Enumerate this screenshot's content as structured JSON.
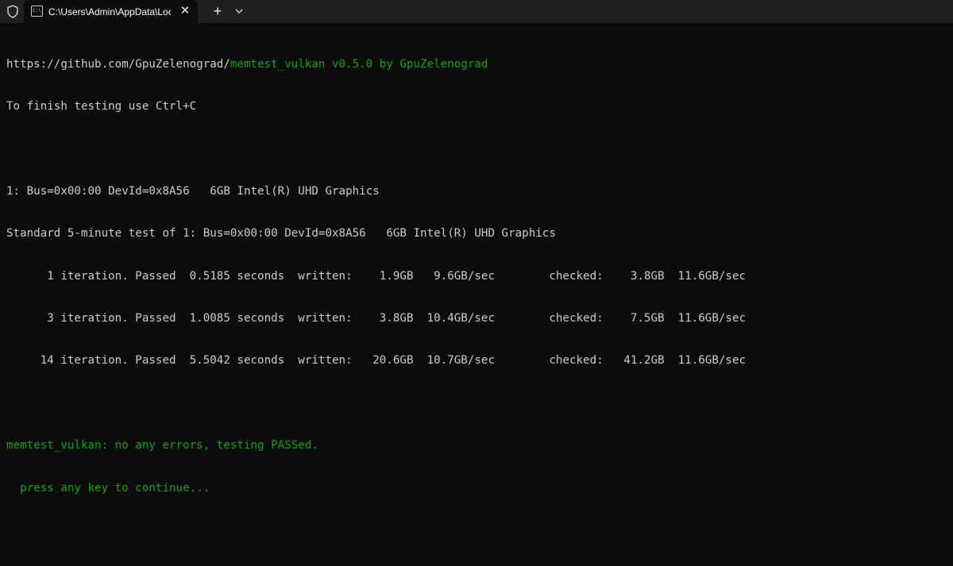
{
  "titlebar": {
    "tab_title": "C:\\Users\\Admin\\AppData\\Local\\Temp\\memtest_vulkan.exe",
    "tab_icon_text": "C:\\",
    "close_glyph": "✕",
    "new_tab_glyph": "+",
    "shield_icon": "shield-icon",
    "dropdown_icon": "chevron-down-icon"
  },
  "terminal": {
    "line_url_prefix": "https://github.com/GpuZelenograd/",
    "line_url_highlight": "memtest_vulkan v0.5.0 by GpuZelenograd",
    "line_finish": "To finish testing use Ctrl+C",
    "line_device": "1: Bus=0x00:00 DevId=0x8A56   6GB Intel(R) UHD Graphics",
    "line_standard": "Standard 5-minute test of 1: Bus=0x00:00 DevId=0x8A56   6GB Intel(R) UHD Graphics",
    "iterations": [
      "      1 iteration. Passed  0.5185 seconds  written:    1.9GB   9.6GB/sec        checked:    3.8GB  11.6GB/sec",
      "      3 iteration. Passed  1.0085 seconds  written:    3.8GB  10.4GB/sec        checked:    7.5GB  11.6GB/sec",
      "     14 iteration. Passed  5.5042 seconds  written:   20.6GB  10.7GB/sec        checked:   41.2GB  11.6GB/sec"
    ],
    "line_result": "memtest_vulkan: no any errors, testing PASSed.",
    "line_continue": "  press any key to continue..."
  },
  "colors": {
    "background": "#0c0c0c",
    "titlebar": "#202020",
    "text": "#cccccc",
    "highlight_green": "#13a10e"
  }
}
